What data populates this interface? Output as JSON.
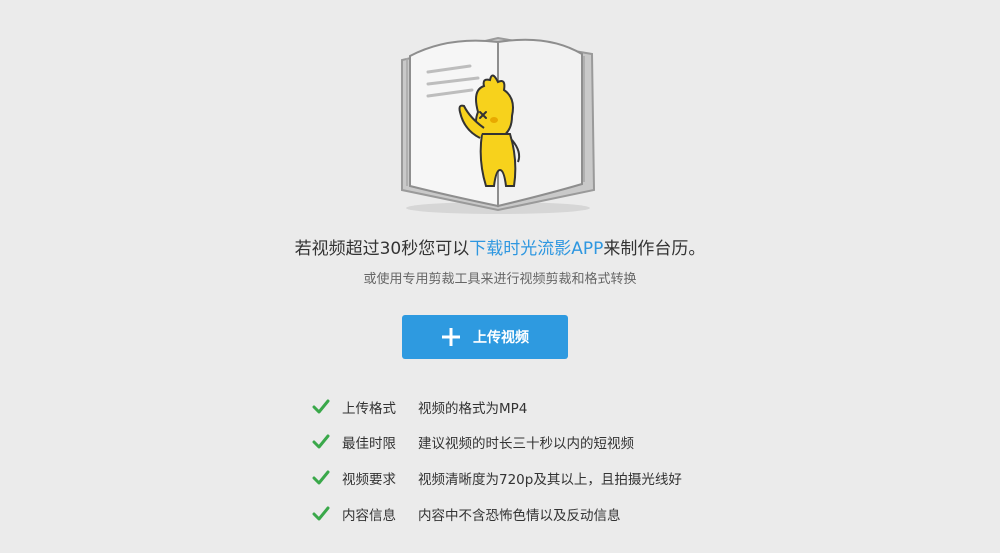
{
  "headline": {
    "before": "若视频超过30秒您可以",
    "link": "下载时光流影APP",
    "after": "来制作台历。"
  },
  "subline": "或使用专用剪裁工具来进行视频剪裁和格式转换",
  "upload_button": {
    "label": "上传视频",
    "icon": "plus-icon",
    "color": "#2e9ae0"
  },
  "link_color": "#2e97e0",
  "check_color": "#3aa84a",
  "requirements": [
    {
      "label": "上传格式",
      "value": "视频的格式为MP4"
    },
    {
      "label": "最佳时限",
      "value": "建议视频的时长三十秒以内的短视频"
    },
    {
      "label": "视频要求",
      "value": "视频清晰度为720p及其以上，且拍摄光线好"
    },
    {
      "label": "内容信息",
      "value": "内容中不含恐怖色情以及反动信息"
    }
  ]
}
